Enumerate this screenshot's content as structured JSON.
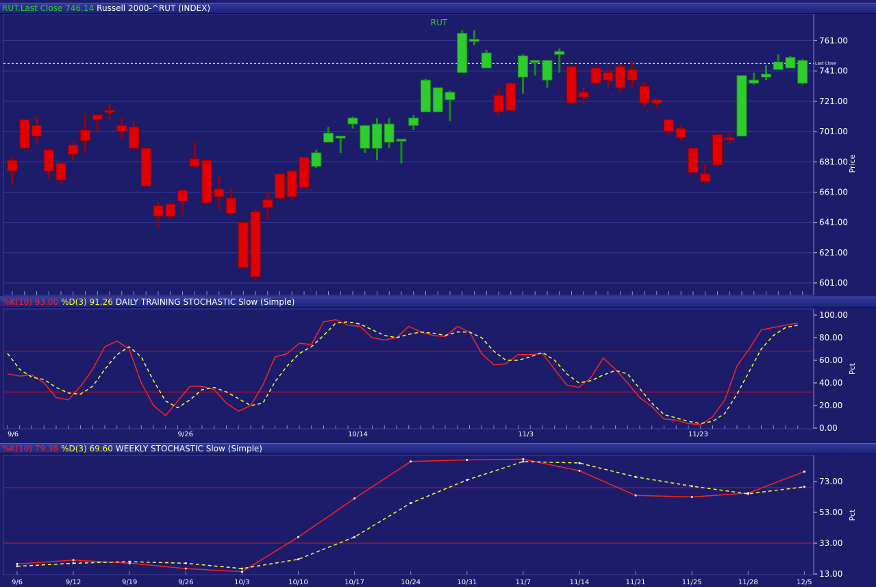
{
  "colors": {
    "background": "#1c1c6b",
    "up": "#2ecc2e",
    "down": "#e00000",
    "k_line": "#ff2020",
    "d_line": "#ffff30",
    "grid": "#3a3f9a"
  },
  "header_price": {
    "symbol_close": "RUT.Last Close 746.14",
    "title": "Russell 2000-^RUT (INDEX)"
  },
  "header_daily": {
    "k": "%K(10) 93.00",
    "d": "%D(3) 91.26",
    "title": "DAILY TRAINING STOCHASTIC Slow (Simple)"
  },
  "header_weekly": {
    "k": "%K(10) 79.38",
    "d": "%D(3) 69.60",
    "title": "WEEKLY STOCHASTIC Slow (Simple)"
  },
  "chart_data": [
    {
      "type": "candlestick",
      "title": "RUT",
      "ylabel": "Price",
      "ylim": [
        601,
        764
      ],
      "yticks": [
        "761.00",
        "741.00",
        "721.00",
        "701.00",
        "681.00",
        "661.00",
        "641.00",
        "621.00",
        "601.00"
      ],
      "last_close": {
        "value": 746.14,
        "label": "Last Close"
      },
      "candles": [
        {
          "o": 675,
          "h": 684,
          "l": 666,
          "c": 682,
          "up": false
        },
        {
          "o": 709,
          "h": 709,
          "l": 690,
          "c": 690,
          "up": false
        },
        {
          "o": 698,
          "h": 711,
          "l": 693,
          "c": 705,
          "up": false
        },
        {
          "o": 689,
          "h": 690,
          "l": 670,
          "c": 675,
          "up": false
        },
        {
          "o": 680,
          "h": 681,
          "l": 666,
          "c": 669,
          "up": false
        },
        {
          "o": 686,
          "h": 694,
          "l": 682,
          "c": 692,
          "up": false
        },
        {
          "o": 702,
          "h": 713,
          "l": 687,
          "c": 695,
          "up": false
        },
        {
          "o": 712,
          "h": 713,
          "l": 701,
          "c": 709,
          "up": false
        },
        {
          "o": 715,
          "h": 719,
          "l": 709,
          "c": 715,
          "up": false
        },
        {
          "o": 701,
          "h": 710,
          "l": 696,
          "c": 705,
          "up": false
        },
        {
          "o": 704,
          "h": 708,
          "l": 690,
          "c": 690,
          "up": false
        },
        {
          "o": 690,
          "h": 690,
          "l": 665,
          "c": 665,
          "up": false
        },
        {
          "o": 645,
          "h": 655,
          "l": 637,
          "c": 652,
          "up": false
        },
        {
          "o": 653,
          "h": 654,
          "l": 643,
          "c": 645,
          "up": false
        },
        {
          "o": 662,
          "h": 663,
          "l": 645,
          "c": 655,
          "up": false
        },
        {
          "o": 678,
          "h": 694,
          "l": 677,
          "c": 683,
          "up": false
        },
        {
          "o": 682,
          "h": 682,
          "l": 654,
          "c": 654,
          "up": false
        },
        {
          "o": 663,
          "h": 672,
          "l": 649,
          "c": 658,
          "up": false
        },
        {
          "o": 657,
          "h": 663,
          "l": 646,
          "c": 647,
          "up": false
        },
        {
          "o": 641,
          "h": 641,
          "l": 611,
          "c": 611,
          "up": false
        },
        {
          "o": 648,
          "h": 650,
          "l": 603,
          "c": 605,
          "up": false
        },
        {
          "o": 656,
          "h": 661,
          "l": 643,
          "c": 651,
          "up": false
        },
        {
          "o": 673,
          "h": 673,
          "l": 656,
          "c": 657,
          "up": false
        },
        {
          "o": 675,
          "h": 676,
          "l": 656,
          "c": 658,
          "up": false
        },
        {
          "o": 684,
          "h": 684,
          "l": 664,
          "c": 664,
          "up": false
        },
        {
          "o": 678,
          "h": 689,
          "l": 677,
          "c": 687,
          "up": true
        },
        {
          "o": 694,
          "h": 704,
          "l": 694,
          "c": 700,
          "up": true
        },
        {
          "o": 698,
          "h": 698,
          "l": 687,
          "c": 698,
          "up": true
        },
        {
          "o": 706,
          "h": 711,
          "l": 703,
          "c": 710,
          "up": true
        },
        {
          "o": 690,
          "h": 705,
          "l": 687,
          "c": 705,
          "up": true
        },
        {
          "o": 690,
          "h": 710,
          "l": 682,
          "c": 706,
          "up": true
        },
        {
          "o": 694,
          "h": 710,
          "l": 690,
          "c": 706,
          "up": true
        },
        {
          "o": 696,
          "h": 696,
          "l": 680,
          "c": 696,
          "up": true
        },
        {
          "o": 705,
          "h": 712,
          "l": 702,
          "c": 710,
          "up": true
        },
        {
          "o": 714,
          "h": 736,
          "l": 714,
          "c": 735,
          "up": true
        },
        {
          "o": 714,
          "h": 730,
          "l": 714,
          "c": 730,
          "up": true
        },
        {
          "o": 722,
          "h": 728,
          "l": 708,
          "c": 727,
          "up": true
        },
        {
          "o": 740,
          "h": 768,
          "l": 740,
          "c": 766,
          "up": true
        },
        {
          "o": 762,
          "h": 768,
          "l": 758,
          "c": 762,
          "up": true
        },
        {
          "o": 743,
          "h": 755,
          "l": 743,
          "c": 753,
          "up": true
        },
        {
          "o": 725,
          "h": 730,
          "l": 712,
          "c": 714,
          "up": false
        },
        {
          "o": 733,
          "h": 733,
          "l": 715,
          "c": 715,
          "up": false
        },
        {
          "o": 737,
          "h": 752,
          "l": 726,
          "c": 751,
          "up": true
        },
        {
          "o": 748,
          "h": 748,
          "l": 738,
          "c": 748,
          "up": true
        },
        {
          "o": 735,
          "h": 748,
          "l": 730,
          "c": 748,
          "up": true
        },
        {
          "o": 752,
          "h": 756,
          "l": 740,
          "c": 754,
          "up": true
        },
        {
          "o": 744,
          "h": 744,
          "l": 720,
          "c": 720,
          "up": false
        },
        {
          "o": 727,
          "h": 730,
          "l": 719,
          "c": 724,
          "up": false
        },
        {
          "o": 743,
          "h": 744,
          "l": 732,
          "c": 733,
          "up": false
        },
        {
          "o": 740,
          "h": 743,
          "l": 730,
          "c": 735,
          "up": false
        },
        {
          "o": 744,
          "h": 746,
          "l": 727,
          "c": 730,
          "up": false
        },
        {
          "o": 742,
          "h": 747,
          "l": 730,
          "c": 735,
          "up": false
        },
        {
          "o": 731,
          "h": 734,
          "l": 717,
          "c": 720,
          "up": false
        },
        {
          "o": 722,
          "h": 724,
          "l": 716,
          "c": 720,
          "up": false
        },
        {
          "o": 709,
          "h": 709,
          "l": 699,
          "c": 701,
          "up": false
        },
        {
          "o": 703,
          "h": 705,
          "l": 695,
          "c": 697,
          "up": false
        },
        {
          "o": 690,
          "h": 690,
          "l": 674,
          "c": 674,
          "up": false
        },
        {
          "o": 673,
          "h": 680,
          "l": 667,
          "c": 668,
          "up": false
        },
        {
          "o": 699,
          "h": 699,
          "l": 678,
          "c": 679,
          "up": false
        },
        {
          "o": 697,
          "h": 701,
          "l": 693,
          "c": 697,
          "up": false
        },
        {
          "o": 698,
          "h": 738,
          "l": 698,
          "c": 738,
          "up": true
        },
        {
          "o": 733,
          "h": 740,
          "l": 732,
          "c": 735,
          "up": true
        },
        {
          "o": 737,
          "h": 745,
          "l": 735,
          "c": 739,
          "up": true
        },
        {
          "o": 742,
          "h": 752,
          "l": 742,
          "c": 747,
          "up": true
        },
        {
          "o": 743,
          "h": 751,
          "l": 743,
          "c": 750,
          "up": true
        },
        {
          "o": 733,
          "h": 749,
          "l": 732,
          "c": 748,
          "up": true
        }
      ]
    },
    {
      "type": "line",
      "title": "DAILY TRAINING STOCHASTIC Slow (Simple)",
      "ylabel": "Pct",
      "ylim": [
        0,
        100
      ],
      "yticks": [
        "100.00",
        "80.00",
        "60.00",
        "40.00",
        "20.00",
        "0.00"
      ],
      "reference_lines": [
        68,
        32
      ],
      "xtick_labels": [
        {
          "i": 0,
          "label": "9/6"
        },
        {
          "i": 14,
          "label": "9/26"
        },
        {
          "i": 28,
          "label": "10/14"
        },
        {
          "i": 42,
          "label": "11/3"
        },
        {
          "i": 56,
          "label": "11/23"
        }
      ],
      "series": [
        {
          "name": "%K(10)",
          "style": "solid",
          "values": [
            48,
            46,
            47,
            40,
            27,
            25,
            37,
            52,
            72,
            77,
            70,
            40,
            20,
            11,
            24,
            37,
            37,
            34,
            22,
            15,
            20,
            38,
            63,
            66,
            75,
            74,
            94,
            96,
            91,
            90,
            80,
            78,
            80,
            90,
            85,
            82,
            81,
            90,
            85,
            66,
            56,
            57,
            65,
            65,
            66,
            52,
            38,
            36,
            45,
            62,
            52,
            40,
            27,
            19,
            8,
            7,
            4,
            3,
            10,
            25,
            55,
            70,
            87,
            89,
            91,
            93
          ]
        },
        {
          "name": "%D(3)",
          "style": "dashed",
          "values": [
            66,
            52,
            45,
            43,
            36,
            31,
            30,
            37,
            52,
            65,
            72,
            63,
            42,
            24,
            18,
            25,
            34,
            36,
            32,
            26,
            20,
            22,
            41,
            55,
            66,
            72,
            82,
            93,
            94,
            92,
            87,
            82,
            80,
            83,
            85,
            84,
            82,
            85,
            85,
            80,
            68,
            60,
            60,
            63,
            67,
            60,
            48,
            40,
            42,
            47,
            51,
            48,
            35,
            22,
            12,
            9,
            6,
            4,
            6,
            13,
            30,
            50,
            70,
            82,
            89,
            91
          ]
        }
      ]
    },
    {
      "type": "line",
      "title": "WEEKLY STOCHASTIC Slow (Simple)",
      "ylabel": "Pct",
      "ylim": [
        13,
        88
      ],
      "yticks": [
        "73.00",
        "53.00",
        "33.00",
        "13.00"
      ],
      "reference_lines": [
        69,
        33
      ],
      "categories": [
        "9/6",
        "9/12",
        "9/19",
        "9/26",
        "10/3",
        "10/10",
        "10/17",
        "10/24",
        "10/31",
        "11/7",
        "11/14",
        "11/21",
        "11/25",
        "11/28",
        "12/5"
      ],
      "series": [
        {
          "name": "%K(10)",
          "style": "solid",
          "values": [
            19.5,
            22,
            20,
            16.5,
            14.5,
            37,
            62,
            86,
            87,
            87.5,
            80,
            64,
            63,
            65.5,
            79.38
          ]
        },
        {
          "name": "%D(3)",
          "style": "dashed",
          "values": [
            18,
            20,
            21,
            20,
            16.5,
            22.5,
            37,
            59,
            74,
            86,
            85,
            76,
            70,
            65,
            69.6
          ]
        }
      ]
    }
  ]
}
